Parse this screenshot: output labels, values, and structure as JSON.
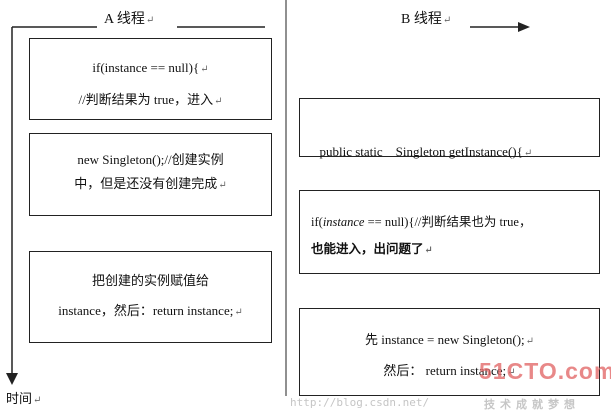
{
  "threads": {
    "a": {
      "title": "A 线程",
      "steps": [
        {
          "lines": [
            "if(instance == null){",
            "//判断结果为 true，进入"
          ]
        },
        {
          "lines": [
            "new Singleton();//创建实例",
            "中，但是还没有创建完成"
          ]
        },
        {
          "lines": [
            "把创建的实例赋值给",
            "instance，然后：return instance;"
          ]
        }
      ]
    },
    "b": {
      "title": "B 线程",
      "steps": [
        {
          "lines": [
            "public static    Singleton getInstance(){"
          ]
        },
        {
          "line1_prefix": "if(",
          "line1_var": "instance",
          "line1_suffix": " == null){//判断结果也为 true，",
          "line2": "也能进入，出问题了"
        },
        {
          "lines": [
            "先 instance = new Singleton();",
            "然后：  return instance;"
          ]
        }
      ]
    }
  },
  "time_axis_label": "时间",
  "paragraph_mark": "↵",
  "watermark": {
    "brand": "51CTO.com",
    "url": "http://blog.csdn.net/",
    "slogan": "技术成就梦想"
  },
  "colors": {
    "line": "#222222",
    "watermark_brand": "#e36b6b",
    "watermark_text": "#b8b8b8"
  }
}
